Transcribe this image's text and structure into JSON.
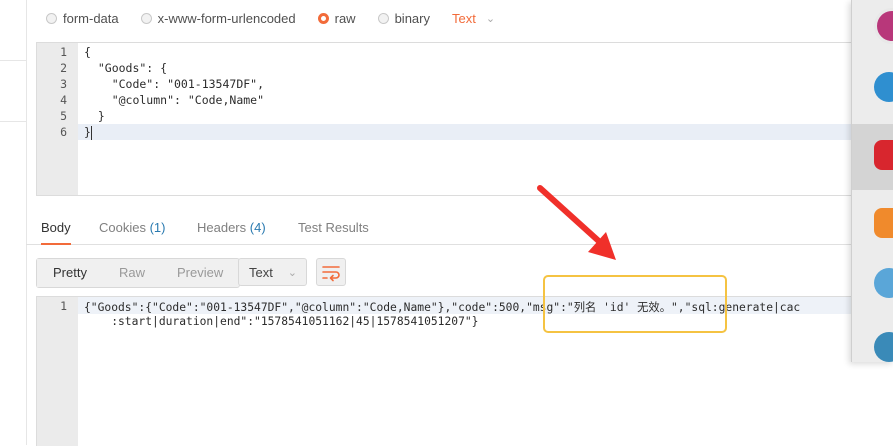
{
  "body_types": {
    "options": [
      "form-data",
      "x-www-form-urlencoded",
      "raw",
      "binary"
    ],
    "selected": "raw",
    "format": "Text"
  },
  "request_editor": {
    "lines": [
      {
        "num": "1",
        "text": "{"
      },
      {
        "num": "2",
        "text": "  \"Goods\": {"
      },
      {
        "num": "3",
        "text": "    \"Code\": \"001-13547DF\","
      },
      {
        "num": "4",
        "text": "    \"@column\": \"Code,Name\""
      },
      {
        "num": "5",
        "text": "  }"
      },
      {
        "num": "6",
        "text": "}"
      }
    ]
  },
  "response_tabs": {
    "body": "Body",
    "cookies": "Cookies",
    "cookies_count": "(1)",
    "headers": "Headers",
    "headers_count": "(4)",
    "test_results": "Test Results"
  },
  "view_modes": {
    "pretty": "Pretty",
    "raw": "Raw",
    "preview": "Preview",
    "format": "Text"
  },
  "response_body": {
    "line_num": "1",
    "line1": "{\"Goods\":{\"Code\":\"001-13547DF\",\"@column\":\"Code,Name\"},\"code\":500,\"msg\":\"列名 'id' 无效。\",\"sql:generate|cac",
    "line1_cont": "    :start|duration|end\":\"1578541051162|45|1578541051207\"}"
  },
  "colors": {
    "accent": "#f26b3a",
    "highlight": "#f5c342",
    "arrow": "#f0302a",
    "count": "#2a7ab0"
  }
}
